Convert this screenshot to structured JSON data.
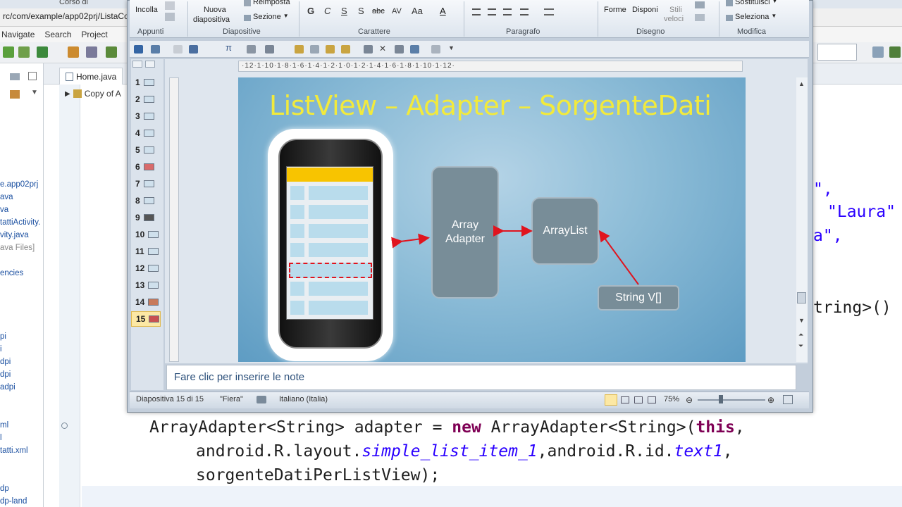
{
  "eclipse": {
    "title_fragment": "Corso di",
    "address_path": "rc/com/example/app02prj/ListaCo",
    "menu": [
      "Navigate",
      "Search",
      "Project"
    ],
    "tabs": {
      "home": "Home.java",
      "copy": "Copy of A"
    },
    "package_explorer": [
      "e.app02prj",
      "ava",
      "va",
      "tattiActivity.",
      "vity.java",
      "ava Files]",
      "encies",
      "pi",
      "i",
      "dpi",
      "dpi",
      "adpi",
      "ml",
      "l",
      "tatti.xml",
      "dp",
      "dp-land"
    ],
    "code_right": {
      "line1": "\",",
      "line2": "\"Laura\"",
      "line3": "a\",",
      "line4": "tring>()"
    },
    "code_bottom": {
      "l1_a": "ArrayAdapter<String> adapter = ",
      "l1_kw_new": "new",
      "l1_b": " ArrayAdapter<String>(",
      "l1_kw_this": "this",
      "l1_c": ",",
      "l2_a": "android.R.layout.",
      "l2_it": "simple_list_item_1",
      "l2_b": ",android.R.id.",
      "l2_it2": "text1",
      "l2_c": ",",
      "l3": "sorgenteDatiPerListView);"
    }
  },
  "ribbon": {
    "paste": "Incolla",
    "new_slide_line1": "Nuova",
    "new_slide_line2": "diapositiva",
    "reset": "Reimposta",
    "section": "Sezione",
    "shapes": "Forme",
    "arrange": "Disponi",
    "quick_styles_line1": "Stili",
    "quick_styles_line2": "veloci",
    "replace": "Sostituisci",
    "select": "Seleziona",
    "groups": [
      "Appunti",
      "Diapositive",
      "Carattere",
      "Paragrafo",
      "Disegno",
      "Modifica"
    ],
    "format_buttons": [
      "G",
      "C",
      "S",
      "S",
      "abc",
      "AV",
      "Aa",
      "A"
    ]
  },
  "ruler": {
    "horizontal": "·12·1·10·1·8·1·6·1·4·1·2·1·0·1·2·1·4·1·6·1·8·1·10·1·12·"
  },
  "slides": [
    "1",
    "2",
    "3",
    "4",
    "5",
    "6",
    "7",
    "8",
    "9",
    "10",
    "11",
    "12",
    "13",
    "14",
    "15"
  ],
  "active_slide": "15",
  "slide": {
    "title": "ListView – Adapter – SorgenteDati",
    "array_adapter_line1": "Array",
    "array_adapter_line2": "Adapter",
    "arraylist": "ArrayList",
    "string_array": "String V[]"
  },
  "notes_placeholder": "Fare clic per inserire le note",
  "status": {
    "slide_counter": "Diapositiva 15 di 15",
    "theme": "\"Fiera\"",
    "language": "Italiano (Italia)",
    "zoom": "75%"
  },
  "colors": {
    "title_yellow": "#f2ea3c",
    "box_gray": "#788d98",
    "arrow_red": "#e0141e",
    "keyword": "#7f0055",
    "italic_field": "#2a00ff"
  }
}
